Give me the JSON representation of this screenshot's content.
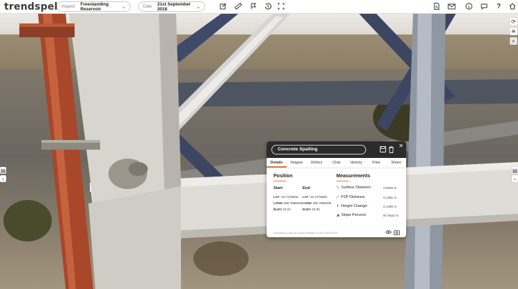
{
  "app": {
    "logo_main": "trendspek",
    "inspect_label": "Inspect",
    "inspect_value": "Freestanding Reservoir",
    "date_label": "Date",
    "date_value": "21st September 2018",
    "toolbar_icons": [
      "edit-icon",
      "ruler-icon",
      "flag-icon",
      "history-icon",
      "fullscreen-icon"
    ],
    "right_icons": [
      "document-icon",
      "email-icon",
      "info-icon",
      "chat-icon",
      "help-icon",
      "home-icon"
    ],
    "help_glyph": "?"
  },
  "panel": {
    "title": "Concrete Spalling",
    "tabs": [
      "Details",
      "Images",
      "Defect",
      "Chat",
      "History",
      "Files",
      "Share"
    ],
    "active_tab": "Details",
    "position_heading": "Position",
    "start_label": "Start",
    "end_label": "End",
    "start": {
      "lat_label": "LAT",
      "lat": "-33.7275819",
      "long_label": "LONG",
      "long": "150.7889348",
      "elev_label": "ELEV",
      "elev": "23.22"
    },
    "end": {
      "lat_label": "LAT",
      "lat": "-33.7275820",
      "long_label": "LONG",
      "long": "150.7889348",
      "elev_label": "ELEV",
      "elev": "23.36"
    },
    "measurements_heading": "Measurements",
    "measurements": [
      {
        "label": "Surface Distance:",
        "value": "0.0000 m"
      },
      {
        "label": "P2P Distance:",
        "value": "0.1381 m"
      },
      {
        "label": "Height Change:",
        "value": "0.1490 m"
      },
      {
        "label": "Slope Percent:",
        "value": "87.6623 %"
      }
    ],
    "footer_note": "Annotation made by David Radcliffe on the 25/02/2019"
  },
  "colors": {
    "accent": "#e07b22",
    "header_dark": "#2b2b2b"
  }
}
